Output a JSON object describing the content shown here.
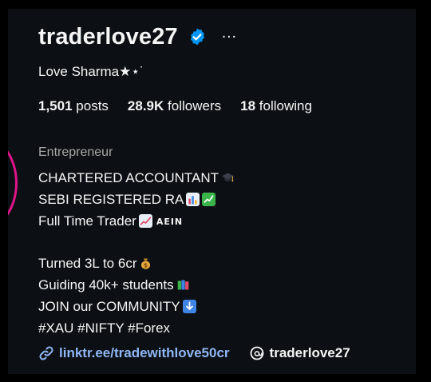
{
  "profile": {
    "username": "traderlove27",
    "verified_icon": "verified-badge-icon",
    "more_icon": "more-options-icon",
    "full_name": "Love Sharma★⋆˙"
  },
  "stats": {
    "posts_count": "1,501",
    "posts_label": "posts",
    "followers_count": "28.9K",
    "followers_label": "followers",
    "following_count": "18",
    "following_label": "following"
  },
  "bio": {
    "category": "Entrepreneur",
    "line1": "CHARTERED ACCOUNTANT",
    "line2": "SEBI REGISTERED RA",
    "line3": "Full Time Trader",
    "line3_tag": "AEIN",
    "line4": "Turned 3L to 6cr",
    "line5": "Guiding 40k+ students",
    "line6": "JOIN our COMMUNITY",
    "line7": "#XAU #NIFTY #Forex"
  },
  "links": {
    "link_text": "linktr.ee/tradewithlove50cr",
    "threads_handle": "traderlove27"
  },
  "colors": {
    "background": "#0c1014",
    "text": "#f5f5f5",
    "muted": "#a8a8a8",
    "link": "#8fb6f5",
    "verified": "#0095f6",
    "story_ring": "#e01489"
  }
}
